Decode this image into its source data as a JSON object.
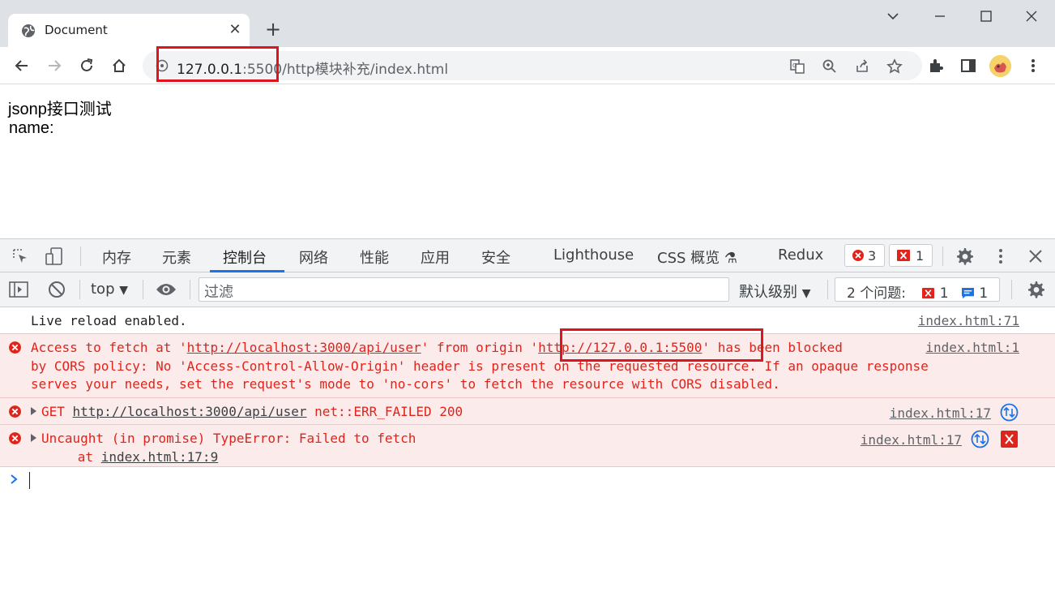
{
  "browser": {
    "tab_title": "Document",
    "url_host": "127.0.0.1",
    "url_rest": ":5500/http模块补充/index.html"
  },
  "page": {
    "line1": "jsonp接口测试",
    "line2": "name:"
  },
  "devtools": {
    "tabs": [
      "内存",
      "元素",
      "控制台",
      "网络",
      "性能",
      "应用",
      "安全",
      "Lighthouse",
      "CSS 概览",
      "Redux"
    ],
    "error_count": "3",
    "issue_count": "1",
    "context": "top",
    "filter_placeholder": "过滤",
    "level": "默认级别",
    "issues_label": "2 个问题:",
    "issues_errors": "1",
    "issues_info": "1"
  },
  "console": {
    "live_reload": "Live reload enabled.",
    "live_reload_src": "index.html:71",
    "cors_pre": "Access to fetch at '",
    "cors_url1": "http://localhost:3000/api/user",
    "cors_mid": "' from origin '",
    "cors_url2": "http://127.0.0.1:5500",
    "cors_post": "' has been blocked",
    "cors_line2": "by CORS policy: No 'Access-Control-Allow-Origin' header is present on the requested resource. If an opaque response",
    "cors_line3": "serves your needs, set the request's mode to 'no-cors' to fetch the resource with CORS disabled.",
    "cors_src": "index.html:1",
    "get_method": "GET ",
    "get_url": "http://localhost:3000/api/user",
    "get_status": " net::ERR_FAILED 200",
    "get_src": "index.html:17",
    "uncaught": "Uncaught (in promise) TypeError: Failed to fetch",
    "uncaught_at": "    at ",
    "uncaught_loc": "index.html:17:9",
    "uncaught_src": "index.html:17"
  },
  "colors": {
    "highlight": "#e0141c",
    "error_text": "#e0241b",
    "accent": "#1a73e8"
  }
}
